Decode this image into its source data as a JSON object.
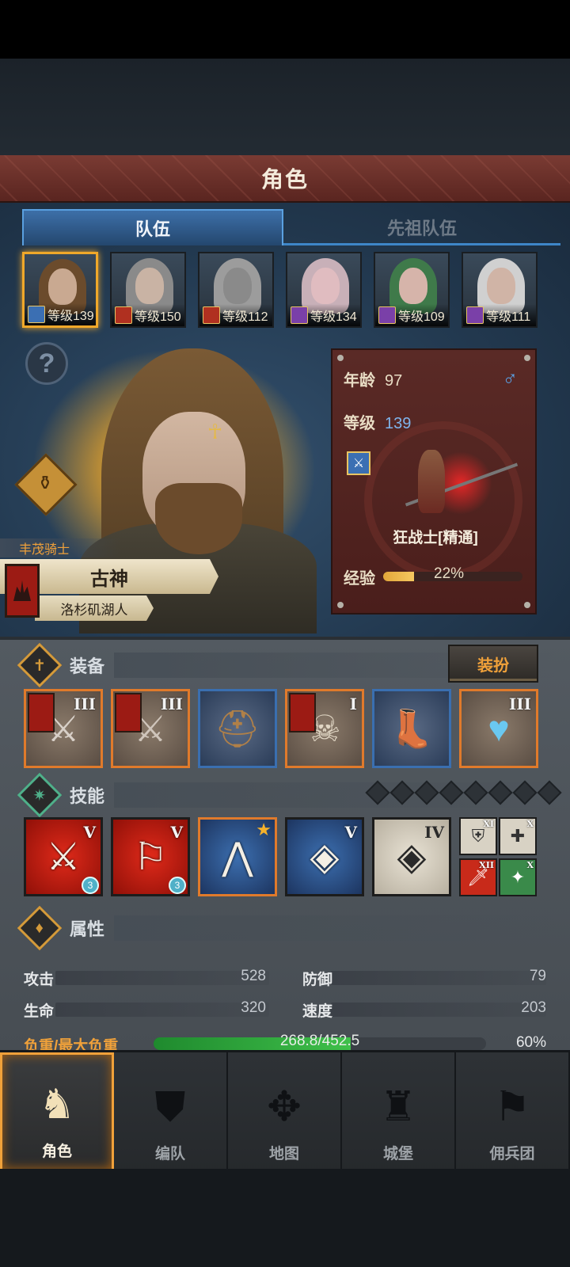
{
  "title": "角色",
  "tabs": [
    {
      "label": "队伍",
      "active": true
    },
    {
      "label": "先祖队伍",
      "active": false
    }
  ],
  "heroes": [
    {
      "level_text": "等级139",
      "class_icon": "sword-icon",
      "class_color": "#3b6fb3",
      "hair_color": "#6b4b2c",
      "face_color": "#c9a991",
      "selected": true
    },
    {
      "level_text": "等级150",
      "class_icon": "horse-icon",
      "class_color": "#b03020",
      "hair_color": "#8a8a8a",
      "face_color": "#c9b3a4",
      "selected": false
    },
    {
      "level_text": "等级112",
      "class_icon": "horse-icon",
      "class_color": "#b03020",
      "hair_color": "#9c9c9c",
      "face_color": "#8a8a8a",
      "selected": false
    },
    {
      "level_text": "等级134",
      "class_icon": "staff-icon",
      "class_color": "#7a40a8",
      "hair_color": "#c8b0b8",
      "face_color": "#e0bcc0",
      "selected": false
    },
    {
      "level_text": "等级109",
      "class_icon": "staff-icon",
      "class_color": "#7a40a8",
      "hair_color": "#3f7a4a",
      "face_color": "#d6b4aa",
      "selected": false
    },
    {
      "level_text": "等级111",
      "class_icon": "staff-icon",
      "class_color": "#7a40a8",
      "hair_color": "#d0d0d0",
      "face_color": "#d0b4a6",
      "selected": false
    }
  ],
  "character": {
    "knight_title": "丰茂骑士",
    "name": "古神",
    "region": "洛杉矶湖人",
    "age_label": "年龄",
    "age": "97",
    "gender_icon": "♂",
    "level_label": "等级",
    "level": "139",
    "job": "狂战士[精通]",
    "exp_label": "经验",
    "exp_percent": "22%",
    "exp_fraction": 0.22
  },
  "equipment": {
    "title": "装备",
    "dress_button": "装扮",
    "slots": [
      {
        "name": "weapon-slot-1",
        "tier": "III",
        "border": "orange",
        "flag": true,
        "glyph": "⚔",
        "glyph_color": "#d8d0c8"
      },
      {
        "name": "weapon-slot-2",
        "tier": "III",
        "border": "orange",
        "flag": true,
        "glyph": "⚔",
        "glyph_color": "#cfc5bb"
      },
      {
        "name": "helmet-slot",
        "tier": "",
        "border": "blue",
        "flag": false,
        "glyph": "⛑",
        "glyph_color": "#b08048"
      },
      {
        "name": "armor-slot",
        "tier": "I",
        "border": "orange",
        "flag": true,
        "glyph": "☠",
        "glyph_color": "#e0d6c4"
      },
      {
        "name": "boots-slot",
        "tier": "",
        "border": "blue",
        "flag": false,
        "glyph": "👢",
        "glyph_color": "#a06a3a"
      },
      {
        "name": "amulet-slot",
        "tier": "III",
        "border": "orange",
        "flag": false,
        "glyph": "♥",
        "glyph_color": "#6ac8f0"
      }
    ]
  },
  "skills": {
    "title": "技能",
    "slot_dots": 8,
    "main": [
      {
        "tier": "V",
        "style": "red",
        "glyph": "⚔",
        "gem": "3",
        "star": false
      },
      {
        "tier": "V",
        "style": "red",
        "glyph": "⚐",
        "gem": "3",
        "star": false
      },
      {
        "tier": "",
        "style": "blue gold",
        "glyph": "⋀",
        "gem": "",
        "star": true
      },
      {
        "tier": "V",
        "style": "blue",
        "glyph": "◈",
        "gem": "",
        "star": false
      },
      {
        "tier": "IV",
        "style": "gray",
        "glyph": "◈",
        "gem": "",
        "star": false
      }
    ],
    "mini": [
      {
        "tier": "XI",
        "bg": "#d8d2c4",
        "glyph": "⛨",
        "color": "#333"
      },
      {
        "tier": "X",
        "bg": "#d8d2c4",
        "glyph": "✚",
        "color": "#333"
      },
      {
        "tier": "XII",
        "bg": "#c82a1a",
        "glyph": "🗡",
        "color": "#fff"
      },
      {
        "tier": "X",
        "bg": "#3a8a4a",
        "glyph": "✦",
        "color": "#fff"
      }
    ]
  },
  "attributes": {
    "title": "属性",
    "attack_label": "攻击",
    "attack": "528",
    "defense_label": "防御",
    "defense": "79",
    "hp_label": "生命",
    "hp": "320",
    "speed_label": "速度",
    "speed": "203",
    "load_label": "负重/最大负重",
    "load_text": "268.8/452.5",
    "load_percent": "60%",
    "load_fraction": 0.594
  },
  "nav": [
    {
      "label": "角色",
      "icon": "knight-icon",
      "glyph": "♞",
      "active": true
    },
    {
      "label": "编队",
      "icon": "formation-icon",
      "glyph": "⛊",
      "active": false
    },
    {
      "label": "地图",
      "icon": "map-icon",
      "glyph": "✥",
      "active": false
    },
    {
      "label": "城堡",
      "icon": "castle-icon",
      "glyph": "♜",
      "active": false
    },
    {
      "label": "佣兵团",
      "icon": "mercenary-icon",
      "glyph": "⚑",
      "active": false
    }
  ]
}
